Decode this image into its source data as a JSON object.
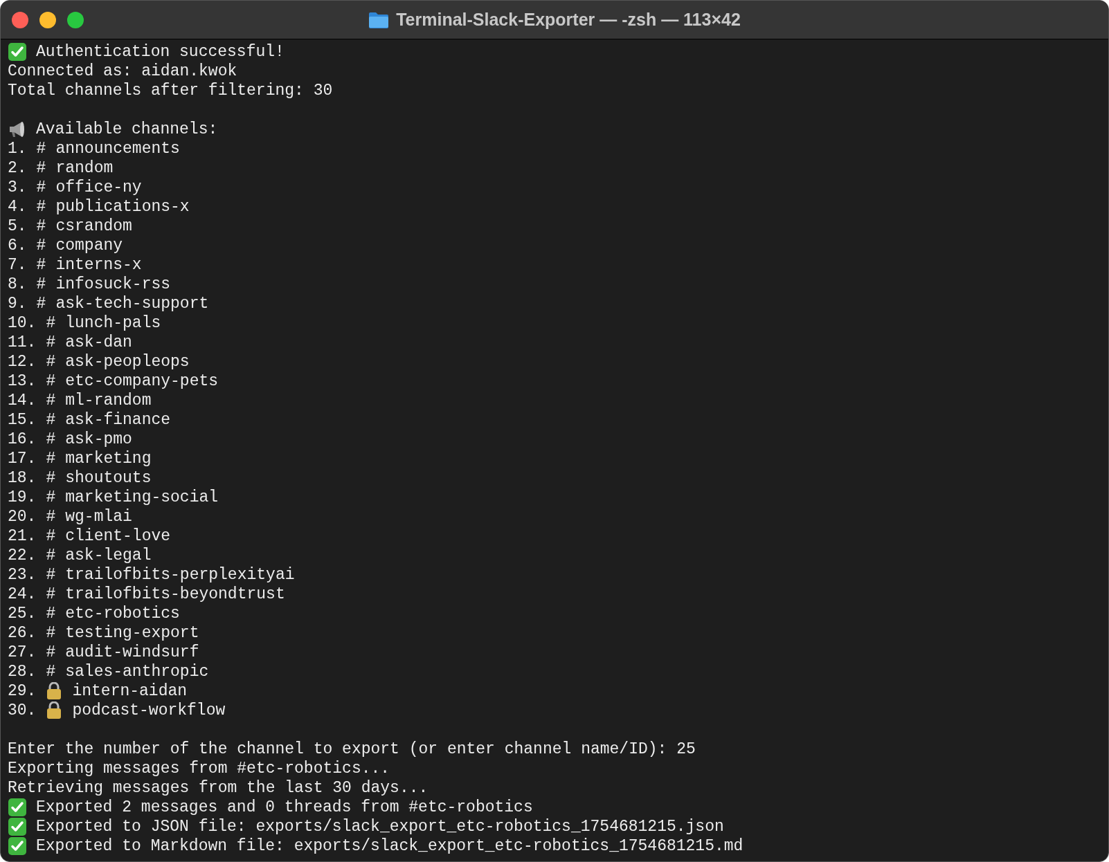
{
  "window": {
    "title": "Terminal-Slack-Exporter — -zsh — 113×42"
  },
  "lines": [
    {
      "kind": "check",
      "text": "Authentication successful!"
    },
    {
      "kind": "text",
      "text": "Connected as: aidan.kwok"
    },
    {
      "kind": "text",
      "text": "Total channels after filtering: 30"
    },
    {
      "kind": "blank"
    },
    {
      "kind": "megaphone",
      "text": "Available channels:"
    },
    {
      "kind": "hash",
      "number": "1.",
      "marker": "#",
      "name": "announcements"
    },
    {
      "kind": "hash",
      "number": "2.",
      "marker": "#",
      "name": "random"
    },
    {
      "kind": "hash",
      "number": "3.",
      "marker": "#",
      "name": "office-ny"
    },
    {
      "kind": "hash",
      "number": "4.",
      "marker": "#",
      "name": "publications-x"
    },
    {
      "kind": "hash",
      "number": "5.",
      "marker": "#",
      "name": "csrandom"
    },
    {
      "kind": "hash",
      "number": "6.",
      "marker": "#",
      "name": "company"
    },
    {
      "kind": "hash",
      "number": "7.",
      "marker": "#",
      "name": "interns-x"
    },
    {
      "kind": "hash",
      "number": "8.",
      "marker": "#",
      "name": "infosuck-rss"
    },
    {
      "kind": "hash",
      "number": "9.",
      "marker": "#",
      "name": "ask-tech-support"
    },
    {
      "kind": "hash",
      "number": "10.",
      "marker": "#",
      "name": "lunch-pals"
    },
    {
      "kind": "hash",
      "number": "11.",
      "marker": "#",
      "name": "ask-dan"
    },
    {
      "kind": "hash",
      "number": "12.",
      "marker": "#",
      "name": "ask-peopleops"
    },
    {
      "kind": "hash",
      "number": "13.",
      "marker": "#",
      "name": "etc-company-pets"
    },
    {
      "kind": "hash",
      "number": "14.",
      "marker": "#",
      "name": "ml-random"
    },
    {
      "kind": "hash",
      "number": "15.",
      "marker": "#",
      "name": "ask-finance"
    },
    {
      "kind": "hash",
      "number": "16.",
      "marker": "#",
      "name": "ask-pmo"
    },
    {
      "kind": "hash",
      "number": "17.",
      "marker": "#",
      "name": "marketing"
    },
    {
      "kind": "hash",
      "number": "18.",
      "marker": "#",
      "name": "shoutouts"
    },
    {
      "kind": "hash",
      "number": "19.",
      "marker": "#",
      "name": "marketing-social"
    },
    {
      "kind": "hash",
      "number": "20.",
      "marker": "#",
      "name": "wg-mlai"
    },
    {
      "kind": "hash",
      "number": "21.",
      "marker": "#",
      "name": "client-love"
    },
    {
      "kind": "hash",
      "number": "22.",
      "marker": "#",
      "name": "ask-legal"
    },
    {
      "kind": "hash",
      "number": "23.",
      "marker": "#",
      "name": "trailofbits-perplexityai"
    },
    {
      "kind": "hash",
      "number": "24.",
      "marker": "#",
      "name": "trailofbits-beyondtrust"
    },
    {
      "kind": "hash",
      "number": "25.",
      "marker": "#",
      "name": "etc-robotics"
    },
    {
      "kind": "hash",
      "number": "26.",
      "marker": "#",
      "name": "testing-export"
    },
    {
      "kind": "hash",
      "number": "27.",
      "marker": "#",
      "name": "audit-windsurf"
    },
    {
      "kind": "hash",
      "number": "28.",
      "marker": "#",
      "name": "sales-anthropic"
    },
    {
      "kind": "lock",
      "number": "29.",
      "name": "intern-aidan"
    },
    {
      "kind": "lock",
      "number": "30.",
      "name": "podcast-workflow"
    },
    {
      "kind": "blank"
    },
    {
      "kind": "text",
      "text": "Enter the number of the channel to export (or enter channel name/ID): 25"
    },
    {
      "kind": "text",
      "text": "Exporting messages from #etc-robotics..."
    },
    {
      "kind": "text",
      "text": "Retrieving messages from the last 30 days..."
    },
    {
      "kind": "check",
      "text": "Exported 2 messages and 0 threads from #etc-robotics"
    },
    {
      "kind": "check",
      "text": "Exported to JSON file: exports/slack_export_etc-robotics_1754681215.json"
    },
    {
      "kind": "check",
      "text": "Exported to Markdown file: exports/slack_export_etc-robotics_1754681215.md"
    }
  ]
}
